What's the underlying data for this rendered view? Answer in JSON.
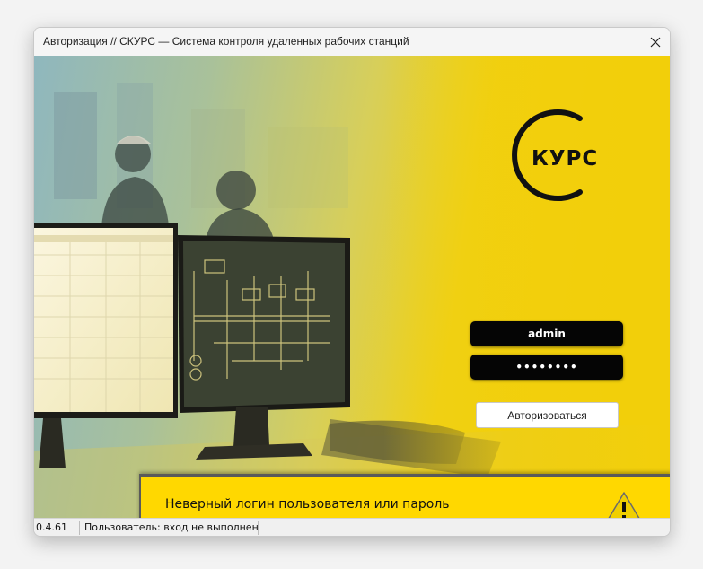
{
  "window": {
    "title": "Авторизация // СКУРС — Система контроля удаленных рабочих станций"
  },
  "logo": {
    "text": "КУРС",
    "icon": "skurs-logo-c-ring"
  },
  "login_form": {
    "username_value": "admin",
    "password_value": "••••••••",
    "submit_label": "Авторизоваться"
  },
  "error_banner": {
    "message": "Неверный логин пользователя или пароль",
    "icon": "warning-icon"
  },
  "statusbar": {
    "version": "0.4.61",
    "user_status": "Пользователь: вход не выполнен"
  },
  "colors": {
    "accent_yellow": "#f2cf0a",
    "input_bg": "#050505",
    "banner_yellow": "#ffd800"
  }
}
